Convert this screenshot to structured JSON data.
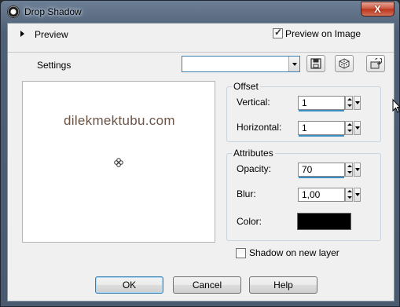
{
  "window": {
    "title": "Drop Shadow",
    "close_label": "X"
  },
  "preview": {
    "label": "Preview",
    "preview_on_image_label": "Preview on Image",
    "preview_on_image_checked": true
  },
  "settings": {
    "label": "Settings",
    "combo_value": ""
  },
  "canvas": {
    "watermark": "dilekmektubu.com"
  },
  "offset": {
    "title": "Offset",
    "vertical_label": "Vertical:",
    "vertical_value": "1",
    "horizontal_label": "Horizontal:",
    "horizontal_value": "1"
  },
  "attributes": {
    "title": "Attributes",
    "opacity_label": "Opacity:",
    "opacity_value": "70",
    "blur_label": "Blur:",
    "blur_value": "1,00",
    "color_label": "Color:",
    "color_value": "#000000"
  },
  "shadow_on_new_layer": {
    "label": "Shadow on new layer",
    "checked": false
  },
  "buttons": {
    "ok": "OK",
    "cancel": "Cancel",
    "help": "Help"
  },
  "icons": [
    "app-icon",
    "triangle-right-icon",
    "save-icon",
    "random-dice-icon",
    "reset-icon",
    "cursor-crosshair-icon"
  ],
  "colors": {
    "accent": "#3a8ec3",
    "titlebar": "#5a6b80",
    "close": "#c9533c"
  }
}
